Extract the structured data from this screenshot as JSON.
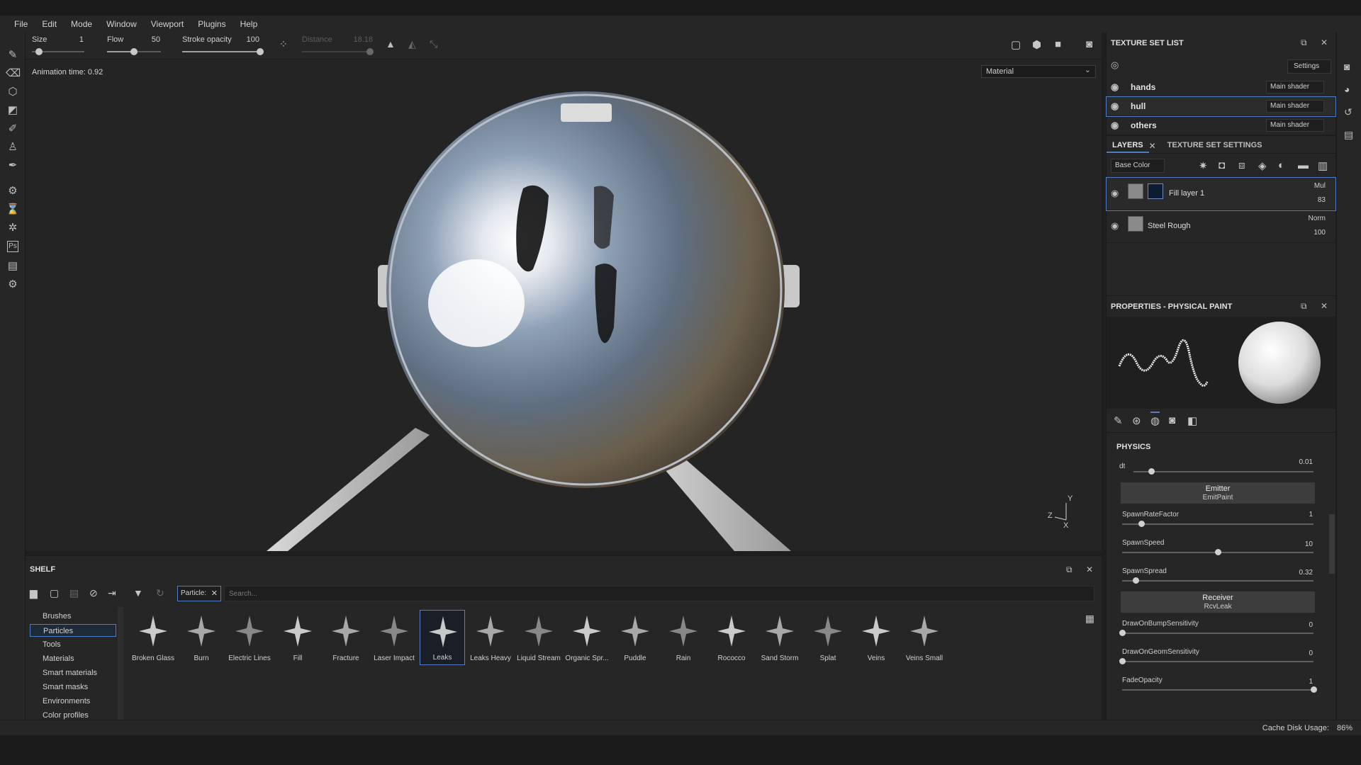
{
  "menu": [
    "File",
    "Edit",
    "Mode",
    "Window",
    "Viewport",
    "Plugins",
    "Help"
  ],
  "tool_options": {
    "size_label": "Size",
    "size_value": "1",
    "flow_label": "Flow",
    "flow_value": "50",
    "stroke_label": "Stroke opacity",
    "stroke_value": "100",
    "distance_label": "Distance",
    "distance_value": "18.18"
  },
  "viewport": {
    "animation_time": "Animation time: 0.92",
    "material_mode": "Material",
    "axes": {
      "y": "Y",
      "z": "Z",
      "x": "X"
    }
  },
  "texture_set_list": {
    "title": "TEXTURE SET LIST",
    "settings_label": "Settings",
    "sets": [
      {
        "name": "hands",
        "shader": "Main shader"
      },
      {
        "name": "hull",
        "shader": "Main shader"
      },
      {
        "name": "others",
        "shader": "Main shader"
      }
    ]
  },
  "layers": {
    "tab_layers": "LAYERS",
    "tab_texture_set_settings": "TEXTURE SET SETTINGS",
    "channel": "Base Color",
    "items": [
      {
        "name": "Fill layer 1",
        "blend": "Mul",
        "opacity": "83"
      },
      {
        "name": "Steel Rough",
        "blend": "Norm",
        "opacity": "100"
      }
    ]
  },
  "properties": {
    "title": "PROPERTIES - PHYSICAL PAINT",
    "section": "PHYSICS",
    "dt_label": "dt",
    "dt_value": "0.01",
    "dt_fraction": 0.1,
    "emitter": {
      "title": "Emitter",
      "sub": "EmitPaint"
    },
    "spawn_rate_label": "SpawnRateFactor",
    "spawn_rate_value": "1",
    "spawn_rate_fraction": 0.1,
    "spawn_speed_label": "SpawnSpeed",
    "spawn_speed_value": "10",
    "spawn_speed_fraction": 0.5,
    "spawn_spread_label": "SpawnSpread",
    "spawn_spread_value": "0.32",
    "spawn_spread_fraction": 0.07,
    "receiver": {
      "title": "Receiver",
      "sub": "RcvLeak"
    },
    "draw_bump_label": "DrawOnBumpSensitivity",
    "draw_bump_value": "0",
    "draw_bump_fraction": 0.0,
    "draw_geom_label": "DrawOnGeomSensitivity",
    "draw_geom_value": "0",
    "draw_geom_fraction": 0.0,
    "fade_label": "FadeOpacity",
    "fade_value": "1",
    "fade_fraction": 1.0
  },
  "shelf": {
    "title": "SHELF",
    "filter_chip": "Particle:",
    "search_placeholder": "Search...",
    "categories": [
      "Brushes",
      "Particles",
      "Tools",
      "Materials",
      "Smart materials",
      "Smart masks",
      "Environments",
      "Color profiles"
    ],
    "selected_category": "Particles",
    "items": [
      "Broken Glass",
      "Burn",
      "Electric Lines",
      "Fill",
      "Fracture",
      "Laser Impact",
      "Leaks",
      "Leaks Heavy",
      "Liquid Stream",
      "Organic Spr...",
      "Puddle",
      "Rain",
      "Rococco",
      "Sand Storm",
      "Splat",
      "Veins",
      "Veins Small"
    ],
    "selected_item": "Leaks"
  },
  "status": {
    "cache_label": "Cache Disk Usage:",
    "cache_value": "86%"
  }
}
